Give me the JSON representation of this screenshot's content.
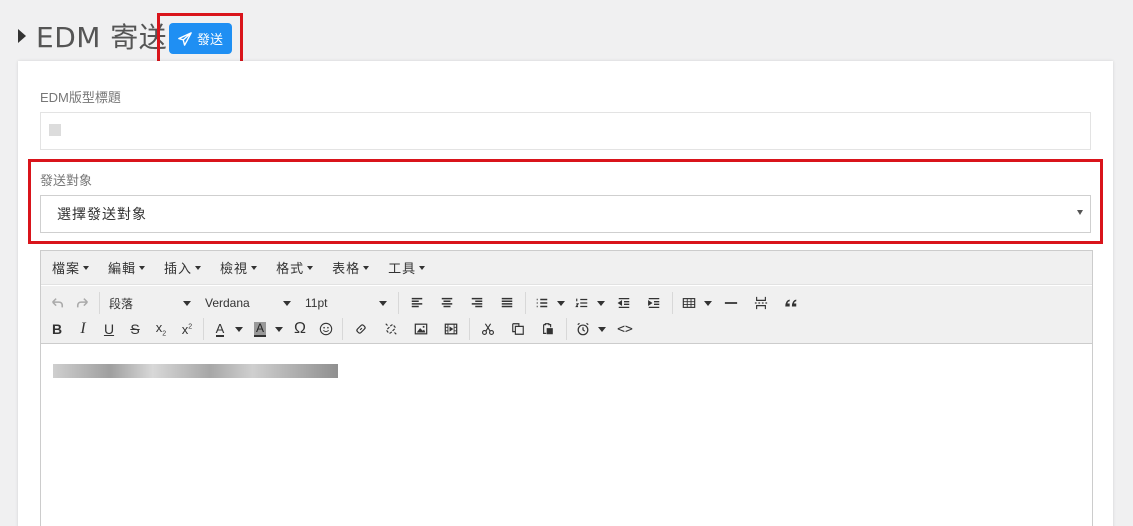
{
  "header": {
    "title": "EDM 寄送",
    "send_button_label": "發送"
  },
  "form": {
    "edm_title_label": "EDM版型標題",
    "edm_title_value": "",
    "target_label": "發送對象",
    "target_select_value": "選擇發送對象"
  },
  "editor": {
    "menu": [
      "檔案",
      "編輯",
      "插入",
      "檢視",
      "格式",
      "表格",
      "工具"
    ],
    "block_format": "段落",
    "font_family": "Verdana",
    "font_size": "11pt"
  },
  "colors": {
    "primary": "#1f8ff3",
    "highlight": "#d9141b"
  }
}
